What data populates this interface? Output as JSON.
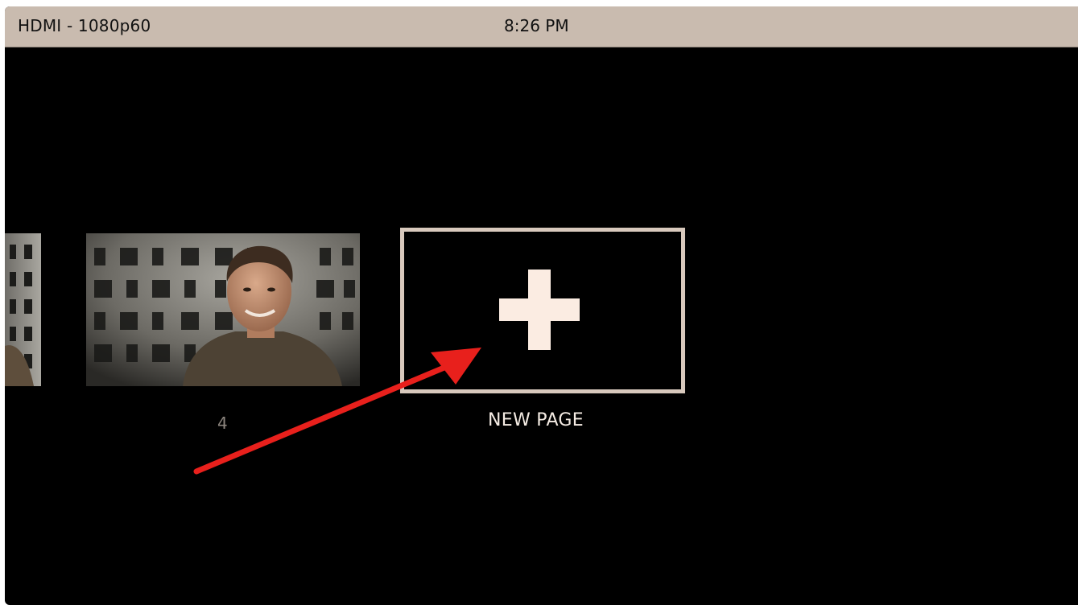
{
  "statusbar": {
    "source": "HDMI - 1080p60",
    "time": "8:26 PM"
  },
  "pages": {
    "items": [
      {
        "label": "4"
      }
    ],
    "new_page_label": "NEW PAGE",
    "new_page_icon": "plus-icon"
  },
  "colors": {
    "statusbar_bg": "#c9bbaf",
    "tile_border": "#d8c9bd",
    "plus": "#fbece2",
    "annotation": "#e8201c"
  },
  "annotation": {
    "icon": "red-arrow-icon"
  }
}
